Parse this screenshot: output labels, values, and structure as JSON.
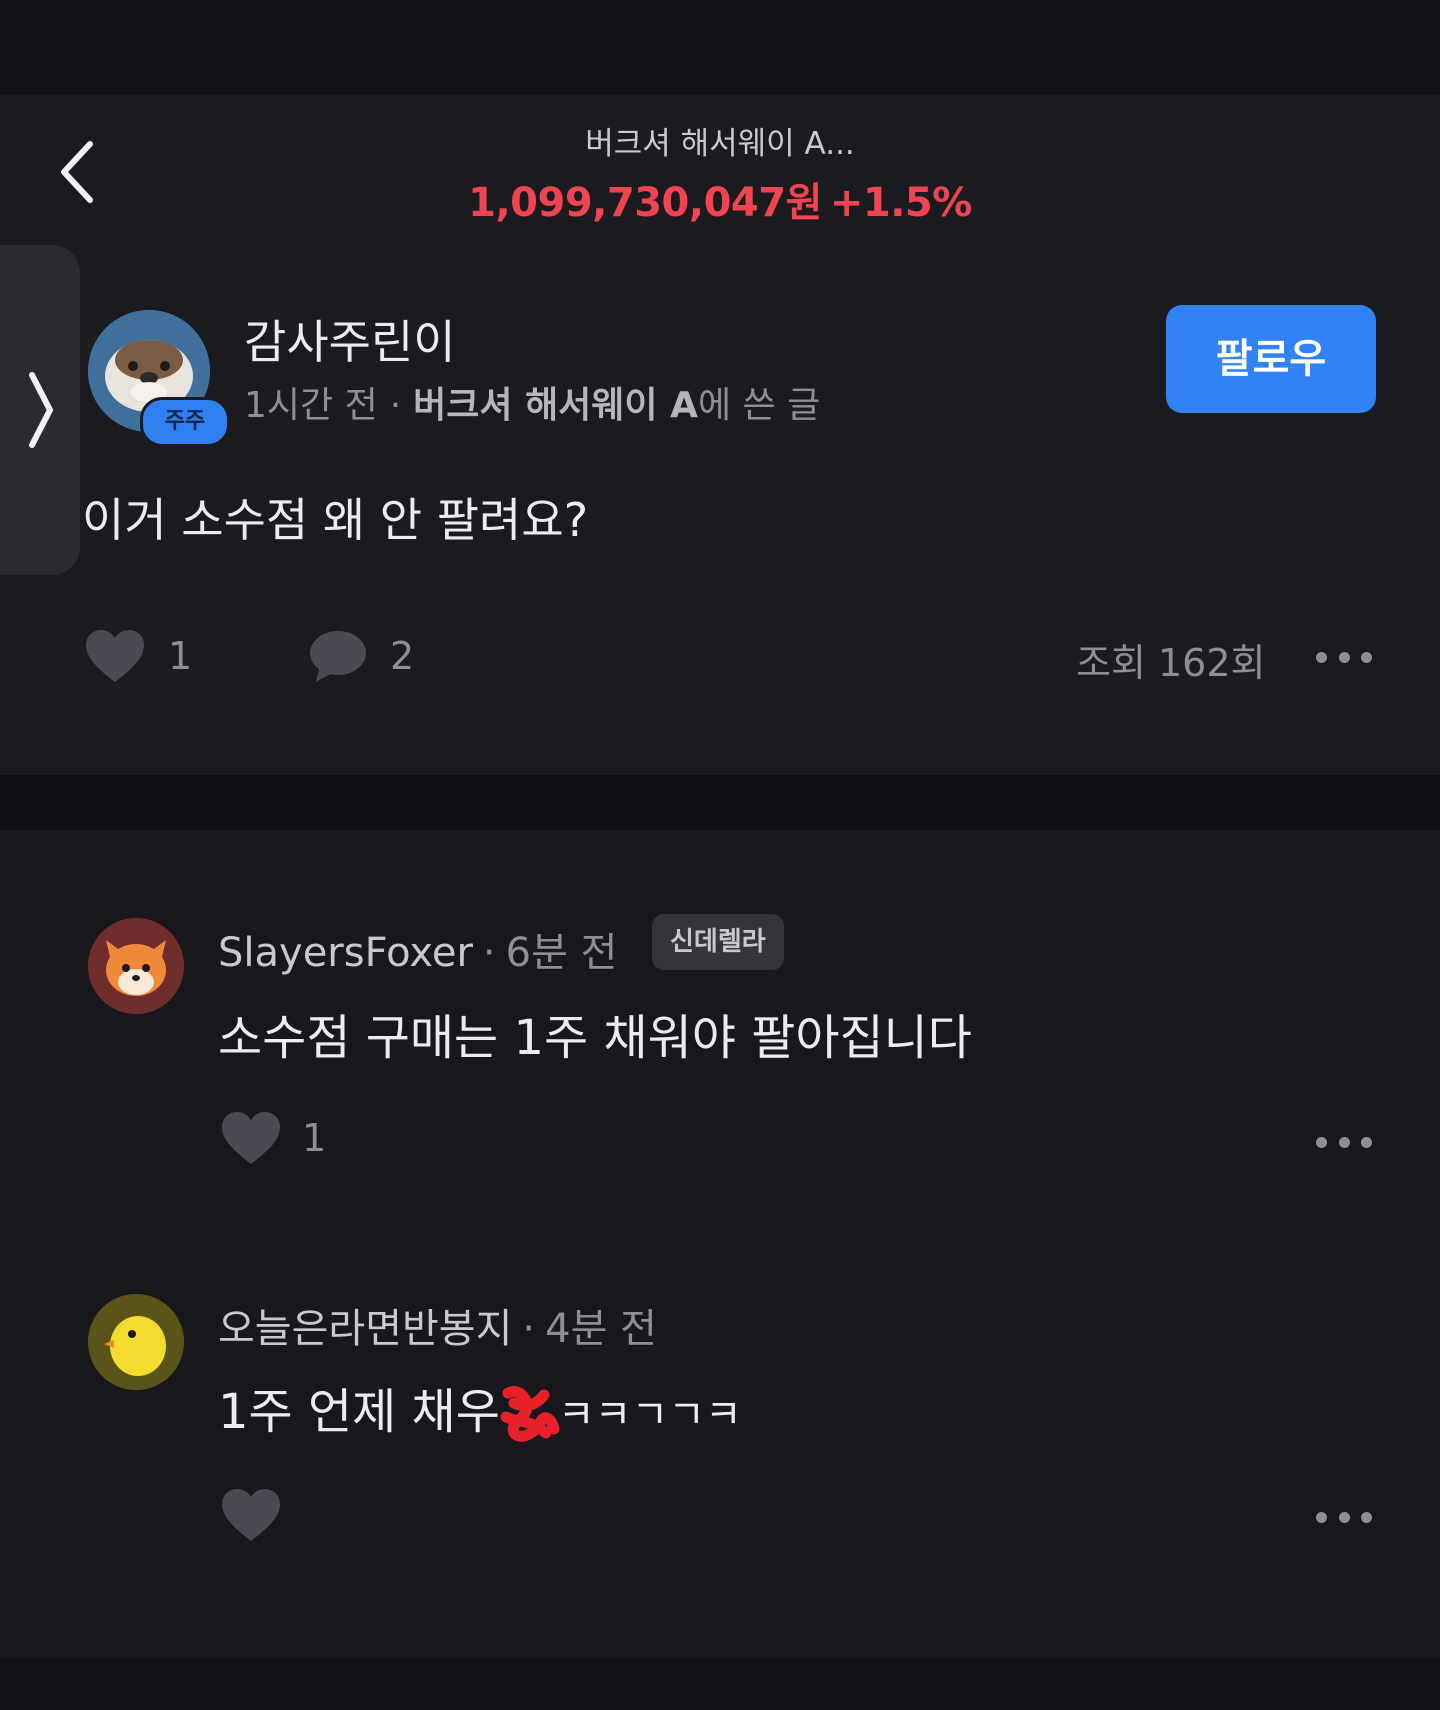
{
  "header": {
    "stock_name": "버크셔 해서웨이 A...",
    "price": "1,099,730,047원",
    "change": "+1.5%",
    "price_color": "#f04452"
  },
  "post": {
    "author": "감사주린이",
    "badge": "주주",
    "time": "1시간 전",
    "meta_separator": "·",
    "stock_ref": "버크셔 해서웨이 A",
    "stock_suffix": "에 쓴 글",
    "follow_label": "팔로우",
    "text": "이거 소수점 왜 안 팔려요?",
    "likes": "1",
    "comments": "2",
    "views": "조회 162회",
    "accent": "#3182f6"
  },
  "comments": [
    {
      "author": "SlayersFoxer",
      "separator": "·",
      "time": "6분 전",
      "badge": "신데렐라",
      "text": "소수점 구매는 1주 채워야 팔아집니다",
      "likes": "1",
      "avatar_icon": "fox-icon"
    },
    {
      "author": "오늘은라면반봉지",
      "separator": "·",
      "time": "4분 전",
      "text_before": "1주 언제 채우",
      "text_after": "ㅋㅋㄱㄱㅋ",
      "likes": "",
      "avatar_icon": "chick-icon"
    }
  ]
}
